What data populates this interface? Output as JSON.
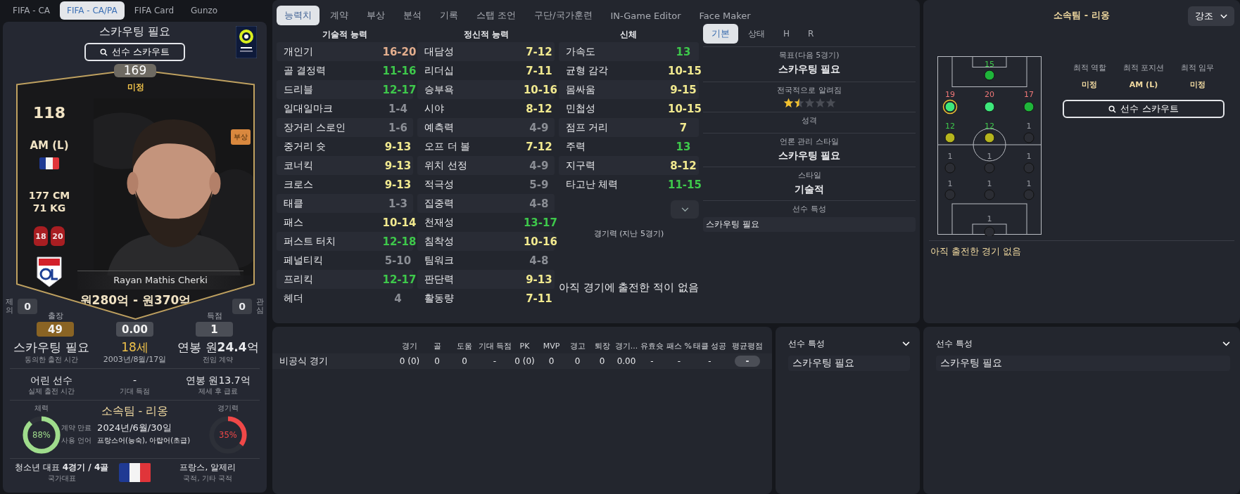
{
  "left_tabs": [
    {
      "label": "FIFA - CA",
      "selected": false
    },
    {
      "label": "FIFA - CA/PA",
      "selected": true
    },
    {
      "label": "FIFA Card",
      "selected": false
    },
    {
      "label": "Gunzo",
      "selected": false
    }
  ],
  "player": {
    "status": "스카우팅 필요",
    "scout_button": "선수 스카우트",
    "ca": "169",
    "ca_note": "미정",
    "rating": "118",
    "position": "AM (L)",
    "height": "177 CM",
    "weight": "71 KG",
    "shirt_numbers": [
      "18",
      "20"
    ],
    "name": "Rayan Mathis Cherki",
    "value": "원280억 - 원370억",
    "injury_badge": "부상",
    "offers_label": "제의",
    "offers": "0",
    "interest_label": "관심",
    "interest": "0"
  },
  "stat_boxes": [
    {
      "label": "출장",
      "value": "49",
      "kind": "highlight"
    },
    {
      "value": "0.00",
      "kind": "plain"
    },
    {
      "label": "득점",
      "value": "1",
      "kind": "plain"
    }
  ],
  "info_rows": [
    {
      "kind": "large",
      "cells": [
        {
          "value": "스카우팅 필요",
          "label": "동의한 출전 시간",
          "kind": "plain"
        },
        {
          "value": "18세",
          "label": "2003년/8월/17일",
          "kind": "age"
        },
        {
          "value": "연봉 원**24.4**억",
          "label": "전임 계약",
          "kind": "plain"
        }
      ]
    },
    {
      "kind": "small",
      "cells": [
        {
          "value": "어린 선수",
          "label": "실제 출전 시간",
          "kind": "plain"
        },
        {
          "value": "-",
          "label": "기대 득점",
          "kind": "plain"
        },
        {
          "value": "연봉 원13.7억",
          "label": "제세 후 급료",
          "kind": "plain"
        }
      ]
    }
  ],
  "condition": {
    "fitness": {
      "label": "체력",
      "reading": "88%",
      "level": 0.88,
      "color": "#9fdc8c"
    },
    "team": "소속팀 - 리옹",
    "contract_label": "계약 만료",
    "contract": "2024년/6월/30일",
    "language_label": "사용 언어",
    "languages": "프랑스어(능숙), 아랍어(초급)",
    "match_form": {
      "label": "경기력",
      "reading": "35%",
      "level": 0.35,
      "color": "#f04848"
    }
  },
  "nationality": {
    "youth": "청소년 대표 **4경기 / 4골**",
    "youth_label": "국가대표",
    "countries": "프랑스, 알제리",
    "countries_label": "국적, 기타 국적"
  },
  "main_tabs": [
    {
      "label": "능력치",
      "selected": true
    },
    {
      "label": "계약",
      "selected": false
    },
    {
      "label": "부상",
      "selected": false
    },
    {
      "label": "분석",
      "selected": false
    },
    {
      "label": "기록",
      "selected": false
    },
    {
      "label": "스탭 조언",
      "selected": false
    },
    {
      "label": "구단/국가훈련",
      "selected": false
    },
    {
      "label": "IN-Game Editor",
      "selected": false
    },
    {
      "label": "Face Maker",
      "selected": false
    }
  ],
  "attributes": [
    {
      "title": "기술적 능력",
      "items": [
        {
          "name": "개인기",
          "value": "16-20",
          "color": "#e3ae8e"
        },
        {
          "name": "골 결정력",
          "value": "11-16",
          "color": "#3ec84b"
        },
        {
          "name": "드리블",
          "value": "12-17",
          "color": "#3ec84b"
        },
        {
          "name": "일대일마크",
          "value": "1-4",
          "color": "#8b8e95"
        },
        {
          "name": "장거리 스로인",
          "value": "1-6",
          "color": "#8b8e95"
        },
        {
          "name": "중거리 슛",
          "value": "9-13",
          "color": "#f1e98f"
        },
        {
          "name": "코너킥",
          "value": "9-13",
          "color": "#f1e98f"
        },
        {
          "name": "크로스",
          "value": "9-13",
          "color": "#f1e98f"
        },
        {
          "name": "태클",
          "value": "1-3",
          "color": "#8b8e95"
        },
        {
          "name": "패스",
          "value": "10-14",
          "color": "#f1e98f"
        },
        {
          "name": "퍼스트 터치",
          "value": "12-18",
          "color": "#3ec84b"
        },
        {
          "name": "페널티킥",
          "value": "5-10",
          "color": "#8b8e95"
        },
        {
          "name": "프리킥",
          "value": "12-17",
          "color": "#3ec84b"
        },
        {
          "name": "헤더",
          "value": "4",
          "color": "#8b8e95"
        }
      ]
    },
    {
      "title": "정신적 능력",
      "items": [
        {
          "name": "대담성",
          "value": "7-12",
          "color": "#f1e98f"
        },
        {
          "name": "리더십",
          "value": "7-11",
          "color": "#f1e98f"
        },
        {
          "name": "승부욕",
          "value": "10-16",
          "color": "#f1e98f"
        },
        {
          "name": "시야",
          "value": "8-12",
          "color": "#f1e98f"
        },
        {
          "name": "예측력",
          "value": "4-9",
          "color": "#8b8e95"
        },
        {
          "name": "오프 더 볼",
          "value": "7-12",
          "color": "#f1e98f"
        },
        {
          "name": "위치 선정",
          "value": "4-9",
          "color": "#8b8e95"
        },
        {
          "name": "적극성",
          "value": "5-9",
          "color": "#8b8e95"
        },
        {
          "name": "집중력",
          "value": "4-8",
          "color": "#8b8e95"
        },
        {
          "name": "천재성",
          "value": "13-17",
          "color": "#3ec84b"
        },
        {
          "name": "침착성",
          "value": "10-16",
          "color": "#f1e98f"
        },
        {
          "name": "팀워크",
          "value": "4-8",
          "color": "#8b8e95"
        },
        {
          "name": "판단력",
          "value": "9-13",
          "color": "#f1e98f"
        },
        {
          "name": "활동량",
          "value": "7-11",
          "color": "#f1e98f"
        }
      ]
    },
    {
      "title": "신체",
      "items": [
        {
          "name": "가속도",
          "value": "13",
          "color": "#3ec84b"
        },
        {
          "name": "균형 감각",
          "value": "10-15",
          "color": "#f1e98f"
        },
        {
          "name": "몸싸움",
          "value": "9-15",
          "color": "#f1e98f"
        },
        {
          "name": "민첩성",
          "value": "10-15",
          "color": "#f1e98f"
        },
        {
          "name": "점프 거리",
          "value": "7",
          "color": "#f1e98f"
        },
        {
          "name": "주력",
          "value": "13",
          "color": "#3ec84b"
        },
        {
          "name": "지구력",
          "value": "8-12",
          "color": "#f1e98f"
        },
        {
          "name": "타고난 체력",
          "value": "11-15",
          "color": "#3ec84b"
        }
      ]
    }
  ],
  "form": {
    "title": "경기력 (지난 5경기)",
    "empty": "아직 경기에 출전한 적이 없음"
  },
  "detail_tabs": [
    {
      "label": "기본",
      "selected": true
    },
    {
      "label": "상태",
      "selected": false
    },
    {
      "label": "H",
      "selected": false
    },
    {
      "label": "R",
      "selected": false
    }
  ],
  "details": [
    {
      "kind": "text",
      "label": "목표(다음 5경기)",
      "value": "스카우팅 필요"
    },
    {
      "kind": "stars",
      "label": "전국적으로 알려짐",
      "stars": 1.5
    },
    {
      "kind": "text",
      "label": "성격"
    },
    {
      "kind": "text",
      "label": "언론 관리 스타일",
      "value": "스카우팅 필요"
    },
    {
      "kind": "text",
      "label": "스타일",
      "value": "기술적"
    },
    {
      "kind": "list",
      "label": "선수 특성",
      "items": [
        "스카우팅 필요"
      ]
    }
  ],
  "team_panel": {
    "title": "소속팀 - 리옹",
    "dropdown": "강조",
    "pitch": [
      {
        "spots": [
          {
            "rating": "15",
            "color": "#1fb53a",
            "kind": "good",
            "selected": false
          }
        ]
      },
      {
        "spots": [
          {
            "rating": "19",
            "color": "#3ee87c",
            "kind": "hot",
            "selected": true
          },
          {
            "rating": "20",
            "color": "#3ee87c",
            "kind": "hot",
            "selected": false
          },
          {
            "rating": "17",
            "color": "#1fb53a",
            "kind": "hot",
            "selected": false
          }
        ]
      },
      {
        "spots": [
          {
            "rating": "12",
            "color": "#b5b51e",
            "kind": "good",
            "selected": false
          },
          {
            "rating": "12",
            "color": "#b5b51e",
            "kind": "good",
            "selected": false
          },
          {
            "rating": "1",
            "color": "#2b2d34",
            "kind": "none",
            "selected": false
          }
        ]
      },
      {
        "spots": [
          {
            "rating": "1",
            "color": "#2b2d34",
            "kind": "none",
            "selected": false
          },
          {
            "rating": "1",
            "color": "#2b2d34",
            "kind": "none",
            "selected": false
          },
          {
            "rating": "1",
            "color": "#2b2d34",
            "kind": "none",
            "selected": false
          }
        ]
      },
      {
        "spots": [
          {
            "rating": "1",
            "color": "#2b2d34",
            "kind": "none",
            "selected": false
          },
          {
            "rating": "1",
            "color": "#2b2d34",
            "kind": "none",
            "selected": false
          },
          {
            "rating": "1",
            "color": "#2b2d34",
            "kind": "none",
            "selected": false
          }
        ]
      },
      {
        "spots": [
          {
            "rating": "1",
            "color": "#2b2d34",
            "kind": "none",
            "selected": false
          }
        ]
      }
    ],
    "best": [
      {
        "label": "최적 역할",
        "value": "미정"
      },
      {
        "label": "최적 포지션",
        "value": "AM (L)"
      },
      {
        "label": "최적 임무",
        "value": "미정"
      }
    ],
    "scout_button": "선수 스카우트",
    "empty": "아직 출전한 경기 없음"
  },
  "match_stats": {
    "columns": [
      "경기",
      "골",
      "도움",
      "기대 득점",
      "PK",
      "MVP",
      "경고",
      "퇴장",
      "경기...",
      "유효슛",
      "패스 %",
      "태클 성공",
      "평균평점"
    ],
    "rows": [
      {
        "label": "비공식 경기",
        "values": [
          "0 (0)",
          "0",
          "0",
          "-",
          "0 (0)",
          "0",
          "0",
          "0",
          "0.00",
          "-",
          "-",
          "-"
        ],
        "rating": "-"
      }
    ]
  },
  "trait_panels": [
    {
      "title": "선수 특성",
      "items": [
        "스카우팅 필요"
      ]
    },
    {
      "title": "선수 특성",
      "items": [
        "스카우팅 필요"
      ]
    }
  ]
}
